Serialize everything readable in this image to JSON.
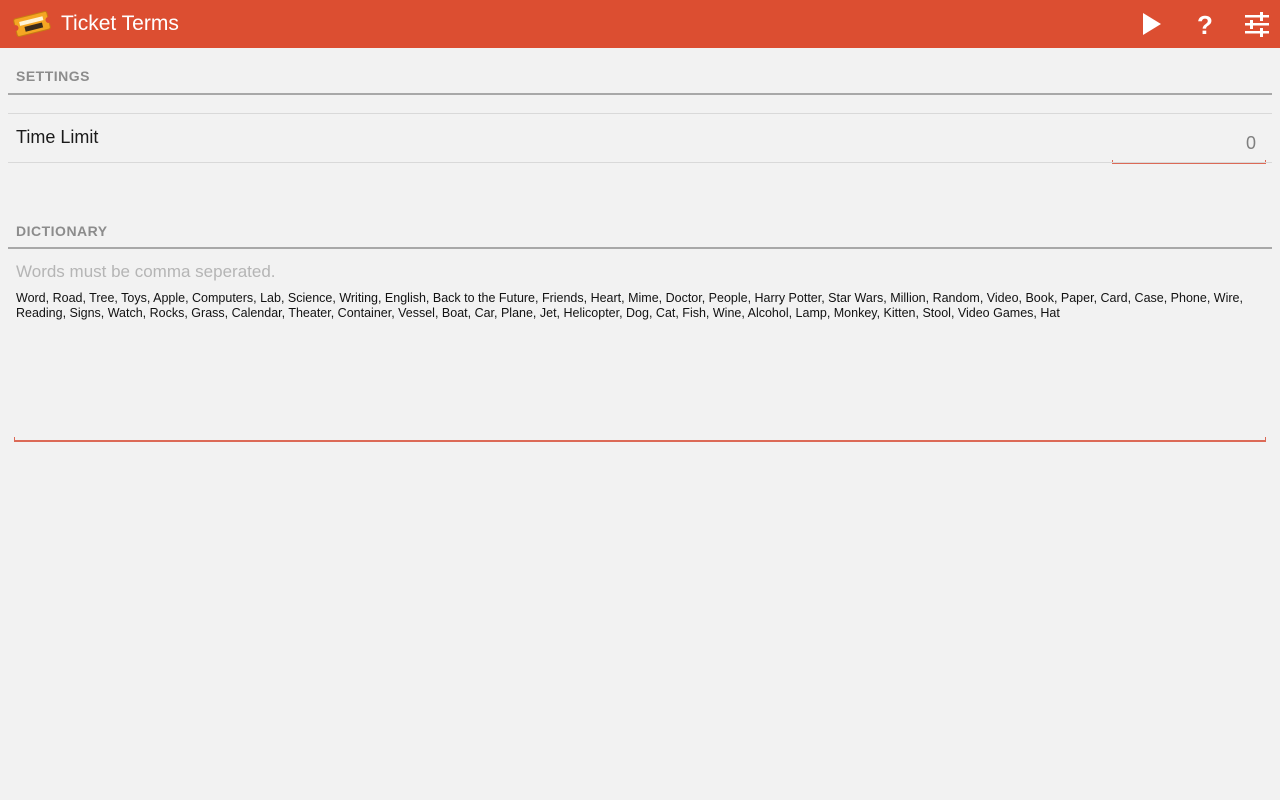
{
  "app": {
    "title": "Ticket Terms",
    "icon": "ticket-icon",
    "accent_color": "#dc4e31"
  },
  "actions": [
    {
      "name": "play",
      "icon": "play-icon"
    },
    {
      "name": "help",
      "icon": "help-icon",
      "glyph": "?"
    },
    {
      "name": "settings",
      "icon": "tune-icon"
    }
  ],
  "settings": {
    "header": "SETTINGS",
    "time_limit": {
      "label": "Time Limit",
      "value": "0"
    }
  },
  "dictionary": {
    "header": "DICTIONARY",
    "placeholder": "Words must be comma seperated.",
    "value": "Word, Road, Tree, Toys, Apple, Computers, Lab, Science, Writing, English, Back to the Future, Friends, Heart, Mime, Doctor, People, Harry Potter, Star Wars, Million, Random, Video, Book, Paper, Card, Case, Phone, Wire, Reading, Signs, Watch, Rocks, Grass, Calendar, Theater, Container, Vessel, Boat, Car, Plane, Jet, Helicopter, Dog, Cat, Fish, Wine, Alcohol, Lamp, Monkey, Kitten, Stool, Video Games, Hat"
  }
}
